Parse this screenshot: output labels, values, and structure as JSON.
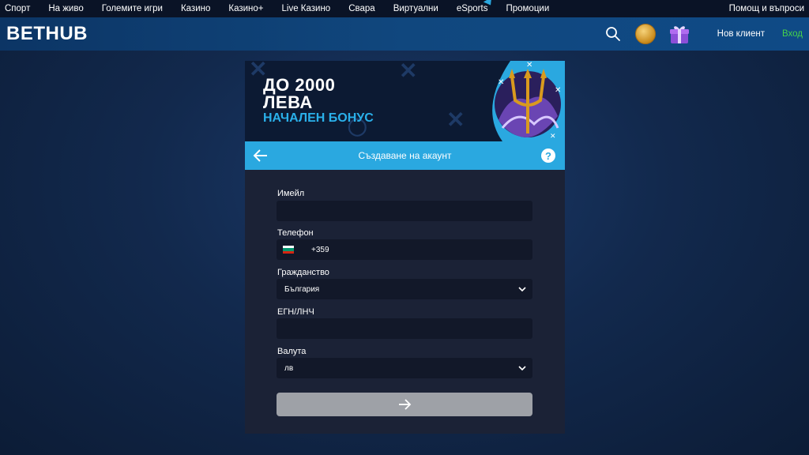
{
  "topnav": {
    "items": [
      "Спорт",
      "На живо",
      "Големите игри",
      "Казино",
      "Казино+",
      "Live Казино",
      "Свара",
      "Виртуални",
      "eSports",
      "Промоции"
    ],
    "help": "Помощ и въпроси"
  },
  "header": {
    "logo": "BETHUB",
    "new_client": "Нов клиент",
    "login": "Вход"
  },
  "banner": {
    "line1": "ДО 2000",
    "line2": "ЛЕВА",
    "line3": "НАЧАЛЕН БОНУС"
  },
  "form": {
    "title": "Създаване на акаунт",
    "help": "?",
    "email_label": "Имейл",
    "email_value": "",
    "phone_label": "Телефон",
    "phone_prefix": "+359",
    "citizenship_label": "Гражданство",
    "citizenship_value": "България",
    "egn_label": "ЕГН/ЛНЧ",
    "egn_value": "",
    "currency_label": "Валута",
    "currency_value": "лв"
  },
  "colors": {
    "accent": "#2aa8e0",
    "login": "#46d34a",
    "submit_disabled": "#9ea1a7"
  },
  "icons": [
    "search-icon",
    "coin-icon",
    "gift-icon",
    "arrow-left-icon",
    "help-icon",
    "bulgaria-flag-icon",
    "chevron-down-icon",
    "arrow-right-icon",
    "trident-icon"
  ]
}
